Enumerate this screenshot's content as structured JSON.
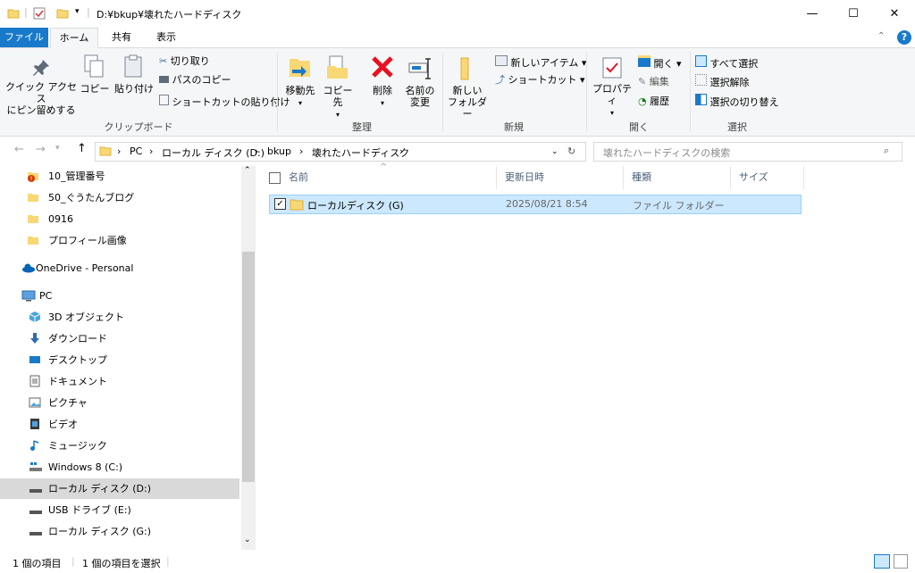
{
  "window": {
    "title": "D:¥bkup¥壊れたハードディスク",
    "minimize": "—",
    "maximize": "☐",
    "close": "✕"
  },
  "tabs": [
    "ファイル",
    "ホーム",
    "共有",
    "表示"
  ],
  "ribbon": {
    "quick_access_l1": "クイック アクセス",
    "quick_access_l2": "にピン留めする",
    "copy": "コピー",
    "paste": "貼り付け",
    "cut": "切り取り",
    "copy_path": "パスのコピー",
    "paste_shortcut": "ショートカットの貼り付け",
    "group_clipboard": "クリップボード",
    "move_to": "移動先",
    "copy_to": "コピー先",
    "delete": "削除",
    "rename_l1": "名前の",
    "rename_l2": "変更",
    "group_organize": "整理",
    "new_folder_l1": "新しい",
    "new_folder_l2": "フォルダー",
    "new_item": "新しいアイテム ▾",
    "shortcut": "ショートカット ▾",
    "group_new": "新規",
    "properties": "プロパティ",
    "open": "開く ▾",
    "edit": "編集",
    "history": "履歴",
    "group_open": "開く",
    "select_all": "すべて選択",
    "select_none": "選択解除",
    "invert_selection": "選択の切り替え",
    "group_select": "選択"
  },
  "address": {
    "crumbs": [
      "PC",
      "ローカル ディスク (D:)",
      "bkup",
      "壊れたハードディスク"
    ],
    "search_placeholder": "壊れたハードディスクの検索"
  },
  "nav": {
    "items": [
      {
        "label": "10_管理番号",
        "icon": "folder-alert-icon"
      },
      {
        "label": "50_ぐうたんブログ",
        "icon": "folder-icon"
      },
      {
        "label": "0916",
        "icon": "folder-icon"
      },
      {
        "label": "プロフィール画像",
        "icon": "folder-icon"
      },
      {
        "label": "OneDrive - Personal",
        "icon": "onedrive-icon"
      },
      {
        "label": "PC",
        "icon": "pc-icon"
      },
      {
        "label": "3D オブジェクト",
        "icon": "3d-objects-icon"
      },
      {
        "label": "ダウンロード",
        "icon": "downloads-icon"
      },
      {
        "label": "デスクトップ",
        "icon": "desktop-icon"
      },
      {
        "label": "ドキュメント",
        "icon": "documents-icon"
      },
      {
        "label": "ピクチャ",
        "icon": "pictures-icon"
      },
      {
        "label": "ビデオ",
        "icon": "videos-icon"
      },
      {
        "label": "ミュージック",
        "icon": "music-icon"
      },
      {
        "label": "Windows 8 (C:)",
        "icon": "drive-c-icon"
      },
      {
        "label": "ローカル ディスク (D:)",
        "icon": "drive-icon"
      },
      {
        "label": "USB ドライブ (E:)",
        "icon": "usb-drive-icon"
      },
      {
        "label": "ローカル ディスク (G:)",
        "icon": "drive-icon"
      }
    ]
  },
  "columns": [
    "名前",
    "更新日時",
    "種類",
    "サイズ"
  ],
  "files": [
    {
      "name": "ローカルディスク (G)",
      "modified": "2025/08/21 8:54",
      "type": "ファイル フォルダー",
      "size": ""
    }
  ],
  "status": {
    "count": "1 個の項目",
    "selected": "1 個の項目を選択"
  },
  "colors": {
    "accent": "#1979ca",
    "selection": "#cce8ff",
    "folder": "#f8d775"
  }
}
